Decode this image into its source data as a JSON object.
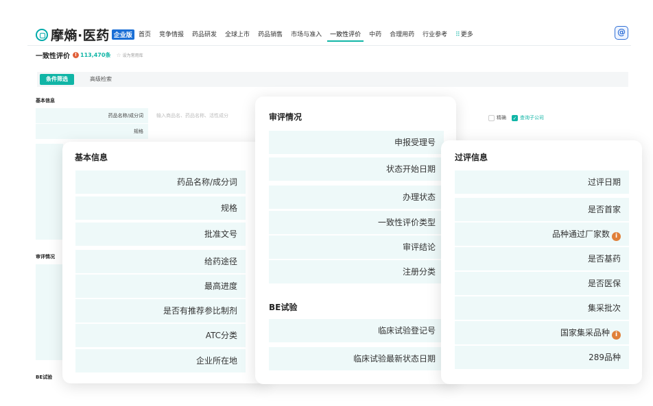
{
  "brand": {
    "name": "摩熵·医药",
    "badge": "企业版"
  },
  "nav": {
    "items": [
      "首页",
      "竞争情报",
      "药品研发",
      "全球上市",
      "药品销售",
      "市场与准入",
      "一致性评价",
      "中药",
      "合理用药",
      "行业参考"
    ],
    "more": "更多",
    "ai_icon": "ai-assistant-icon"
  },
  "page": {
    "title": "一致性评价",
    "count": "113,470条",
    "fav": "设为常用库"
  },
  "tabs": [
    "条件筛选",
    "高级检索"
  ],
  "base": {
    "basic_label": "基本信息",
    "review_label": "审评情况",
    "be_label": "BE试验",
    "name_label": "药品名称/成分词",
    "name_placeholder": "输入商品名、药品名称、活性成分",
    "spec_label": "规格",
    "exact": "精确",
    "sub_company": "查询子公司"
  },
  "card_basic": {
    "title": "基本信息",
    "rows": [
      "药品名称/成分词",
      "规格",
      "批准文号",
      "给药途径",
      "最高进度",
      "是否有推荐参比制剂",
      "ATC分类",
      "企业所在地"
    ]
  },
  "card_review": {
    "title": "审评情况",
    "rows": [
      "申报受理号",
      "状态开始日期",
      "办理状态",
      "一致性评价类型",
      "审评结论",
      "注册分类"
    ],
    "be_title": "BE试验",
    "be_rows": [
      "临床试验登记号",
      "临床试验最新状态日期"
    ]
  },
  "card_pass": {
    "title": "过评信息",
    "rows": [
      "过评日期",
      "是否首家",
      "品种通过厂家数",
      "是否基药",
      "是否医保",
      "集采批次",
      "国家集采品种",
      "289品种"
    ],
    "info_icon": "info-icon"
  }
}
